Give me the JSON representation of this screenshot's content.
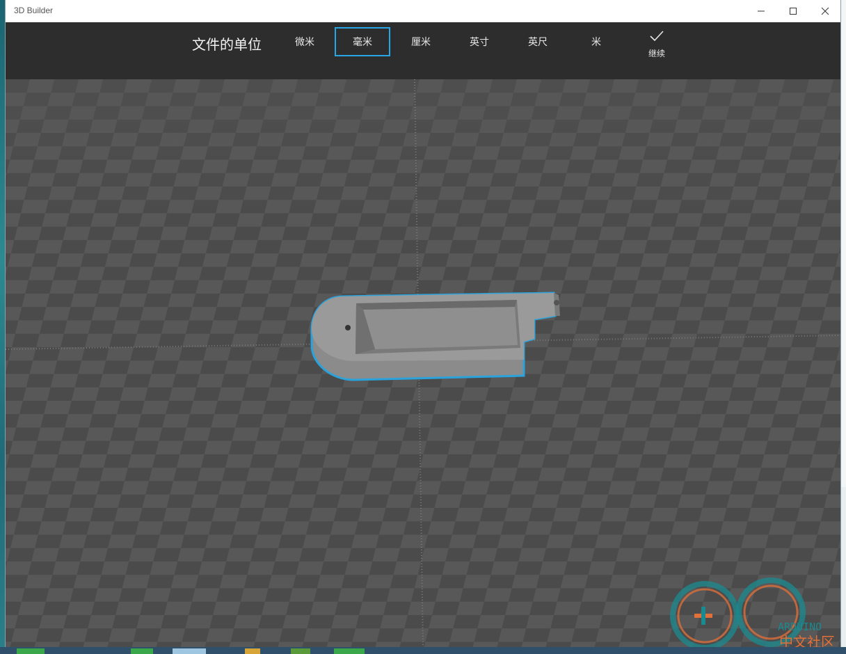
{
  "window": {
    "app_title": "3D Builder",
    "controls": [
      "minimize",
      "maximize",
      "close"
    ]
  },
  "toolbar": {
    "title": "文件的单位",
    "units": [
      {
        "label": "微米",
        "selected": false
      },
      {
        "label": "毫米",
        "selected": true
      },
      {
        "label": "厘米",
        "selected": false
      },
      {
        "label": "英寸",
        "selected": false
      },
      {
        "label": "英尺",
        "selected": false
      },
      {
        "label": "米",
        "selected": false
      }
    ],
    "continue_label": "继续",
    "continue_icon": "check-icon"
  },
  "viewport": {
    "grid_colors": [
      "#555555",
      "#4a4a4a"
    ],
    "model_color": "#8f8f8f",
    "selection_outline_color": "#2aa3dc"
  },
  "watermark": {
    "brand": "ARDUINO",
    "caption": "中文社区",
    "colors": {
      "teal": "#1b8a8f",
      "orange": "#e2703a"
    }
  }
}
